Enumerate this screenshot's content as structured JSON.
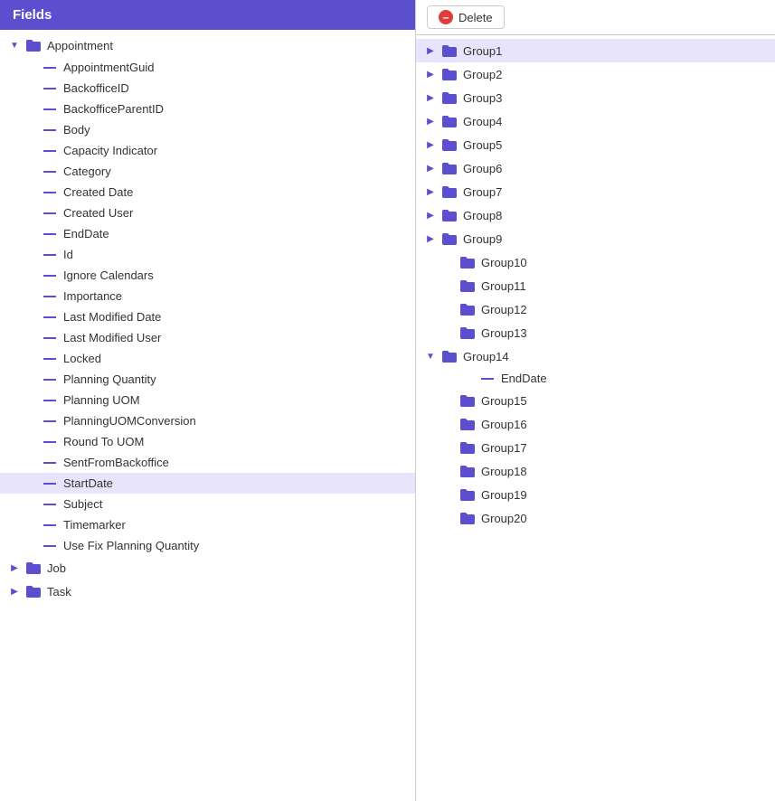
{
  "leftPanel": {
    "header": "Fields",
    "tree": {
      "appointment": {
        "label": "Appointment",
        "expanded": true,
        "children": [
          "AppointmentGuid",
          "BackofficeID",
          "BackofficeParentID",
          "Body",
          "Capacity Indicator",
          "Category",
          "Created Date",
          "Created User",
          "EndDate",
          "Id",
          "Ignore Calendars",
          "Importance",
          "Last Modified Date",
          "Last Modified User",
          "Locked",
          "Planning Quantity",
          "Planning UOM",
          "PlanningUOMConversion",
          "Round To UOM",
          "SentFromBackoffice",
          "StartDate",
          "Subject",
          "Timemarker",
          "Use Fix Planning Quantity"
        ]
      },
      "job": {
        "label": "Job",
        "expanded": false
      },
      "task": {
        "label": "Task",
        "expanded": false
      }
    }
  },
  "rightPanel": {
    "toolbar": {
      "deleteLabel": "Delete"
    },
    "groups": [
      {
        "id": "Group1",
        "expanded": false,
        "selected": true,
        "children": []
      },
      {
        "id": "Group2",
        "expanded": false,
        "children": []
      },
      {
        "id": "Group3",
        "expanded": false,
        "children": []
      },
      {
        "id": "Group4",
        "expanded": false,
        "children": []
      },
      {
        "id": "Group5",
        "expanded": false,
        "children": []
      },
      {
        "id": "Group6",
        "expanded": false,
        "children": []
      },
      {
        "id": "Group7",
        "expanded": false,
        "children": []
      },
      {
        "id": "Group8",
        "expanded": false,
        "children": []
      },
      {
        "id": "Group9",
        "expanded": false,
        "children": []
      },
      {
        "id": "Group10",
        "expanded": false,
        "children": []
      },
      {
        "id": "Group11",
        "expanded": false,
        "children": []
      },
      {
        "id": "Group12",
        "expanded": false,
        "children": []
      },
      {
        "id": "Group13",
        "expanded": false,
        "children": []
      },
      {
        "id": "Group14",
        "expanded": true,
        "children": [
          "EndDate"
        ]
      },
      {
        "id": "Group15",
        "expanded": false,
        "children": []
      },
      {
        "id": "Group16",
        "expanded": false,
        "children": []
      },
      {
        "id": "Group17",
        "expanded": false,
        "children": []
      },
      {
        "id": "Group18",
        "expanded": false,
        "children": []
      },
      {
        "id": "Group19",
        "expanded": false,
        "children": []
      },
      {
        "id": "Group20",
        "expanded": false,
        "children": []
      }
    ]
  },
  "icons": {
    "folderOpen": "📁",
    "folderClosed": "📁",
    "expand": "▶",
    "collapse": "▼"
  }
}
